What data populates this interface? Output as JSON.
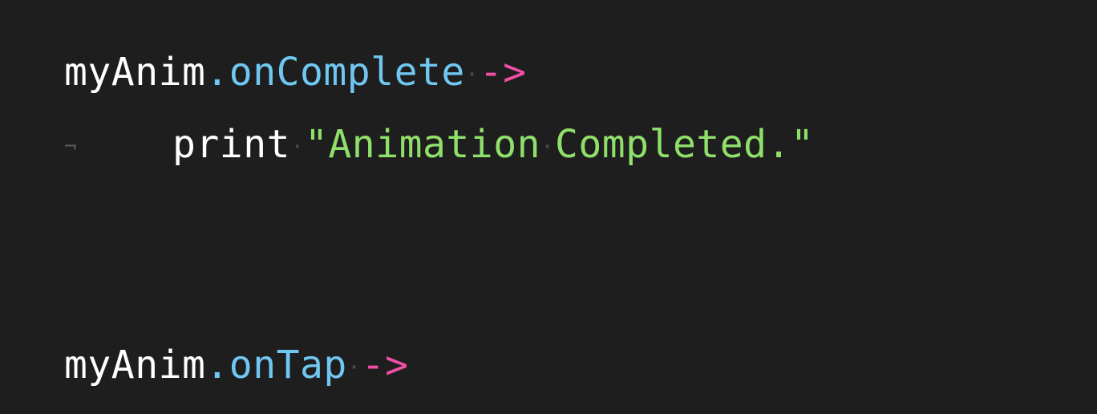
{
  "code": {
    "line1": {
      "object": "myAnim",
      "member": ".onComplete",
      "arrow": "->"
    },
    "line2": {
      "tab_marker": "¬",
      "keyword": "print",
      "string": "\"Animation Completed.\""
    },
    "line3": {
      "object": "myAnim",
      "member": ".onTap",
      "arrow": "->"
    },
    "whitespace_dot": "·"
  },
  "colors": {
    "background": "#1e1e1e",
    "identifier": "#ffffff",
    "property": "#6fc7f2",
    "arrow": "#ef4fa6",
    "string": "#8fe06a",
    "invisible": "#4a4a4a"
  }
}
